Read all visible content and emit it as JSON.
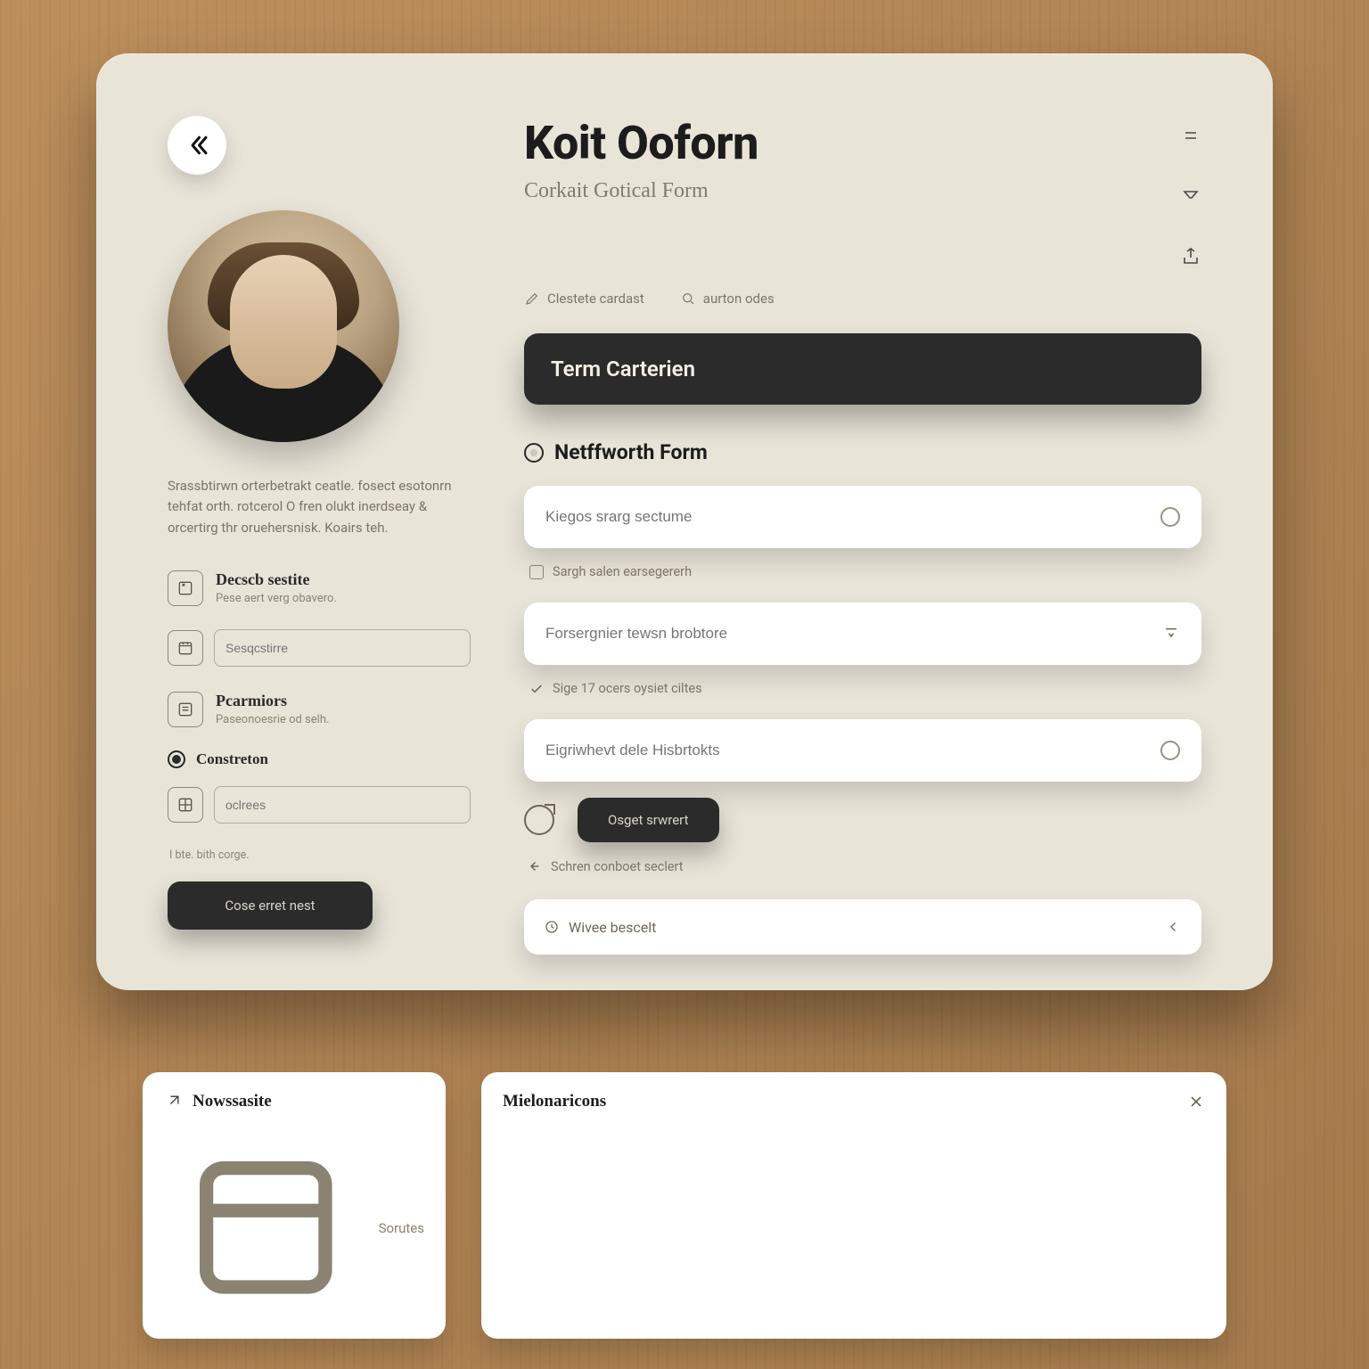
{
  "header": {
    "title": "Koit Ooforn",
    "subtitle": "Corkait Gotical Form",
    "meta1": "Clestete cardast",
    "meta2": "aurton odes"
  },
  "banner": {
    "label": "Term Carterien"
  },
  "section": {
    "title": "Netffworth Form"
  },
  "fields": {
    "f1_placeholder": "Kiegos srarg sectume",
    "f1_check": "Sargh salen earsegererh",
    "f2_placeholder": "Forsergnier tewsn brobtore",
    "f2_check": "Sige 17 ocers oysiet ciltes",
    "f3_placeholder": "Eigriwhevt dele Hisbrtokts"
  },
  "actions": {
    "primary": "Osget srwrert",
    "note": "Schren conboet seclert",
    "foot_dark": "Wivee bescelt",
    "foot_left": "Cose erret nest"
  },
  "left": {
    "bio": "Srassbtirwn orterbetrakt ceatle. fosect esotonrn tehfat orth. rotcerol O fren olukt inerdseay & orcertirg thr oruehersnisk. Koairs teh.",
    "block1_title": "Decscb sestite",
    "block1_sub": "Pese aert verg obavero.",
    "input1_placeholder": "Sesqcstirre",
    "block2_title": "Pcarmiors",
    "block2_sub": "Paseonoesrie od selh.",
    "radio_label": "Constreton",
    "input2_placeholder": "oclrees",
    "hint": "I bte. bith corge."
  },
  "bottom": {
    "card1_title": "Nowssasite",
    "card1_row": "Sorutes",
    "card2_title": "Mielonaricons"
  }
}
